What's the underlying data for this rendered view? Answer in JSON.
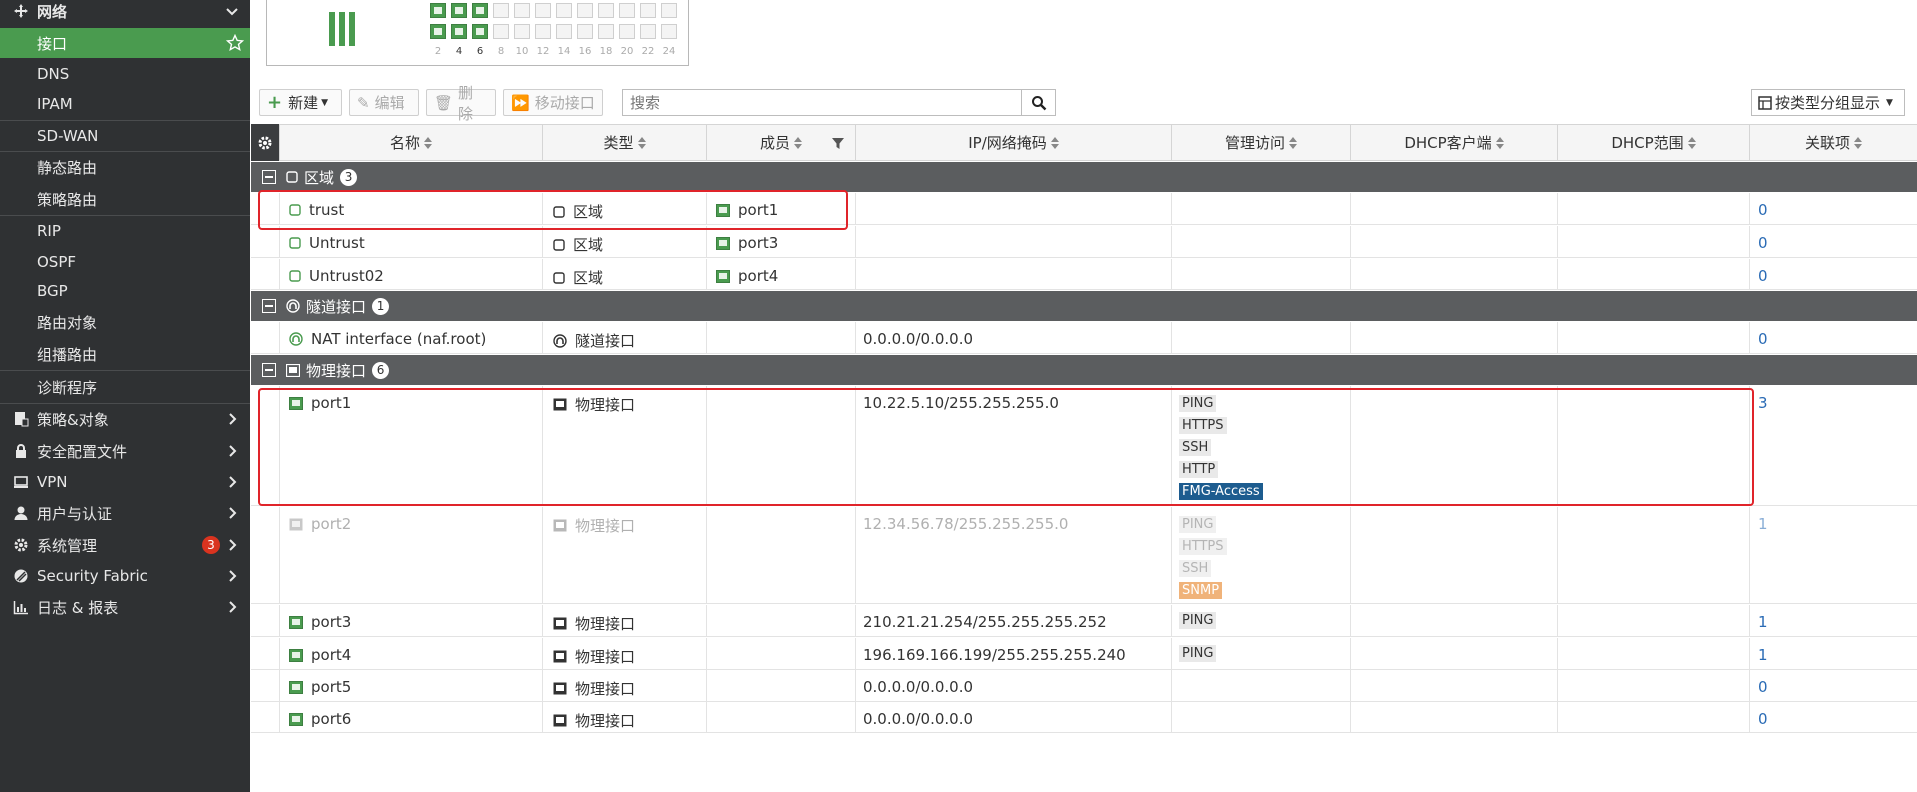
{
  "sidebar": {
    "network": "网络",
    "items": [
      {
        "label": "接口",
        "active": true
      },
      {
        "label": "DNS"
      },
      {
        "label": "IPAM"
      },
      {
        "label": "SD-WAN"
      },
      {
        "label": "静态路由"
      },
      {
        "label": "策略路由"
      },
      {
        "label": "RIP"
      },
      {
        "label": "OSPF"
      },
      {
        "label": "BGP"
      },
      {
        "label": "路由对象"
      },
      {
        "label": "组播路由"
      },
      {
        "label": "诊断程序"
      }
    ],
    "sections": [
      {
        "label": "策略&对象",
        "icon": "policy-icon"
      },
      {
        "label": "安全配置文件",
        "icon": "lock-icon"
      },
      {
        "label": "VPN",
        "icon": "monitor-icon"
      },
      {
        "label": "用户与认证",
        "icon": "user-icon"
      },
      {
        "label": "系统管理",
        "icon": "gear-icon",
        "badge": "3"
      },
      {
        "label": "Security Fabric",
        "icon": "fabric-icon"
      },
      {
        "label": "日志 & 报表",
        "icon": "chart-icon"
      }
    ]
  },
  "port_widget": {
    "numbers": [
      "2",
      "4",
      "6",
      "8",
      "10",
      "12",
      "14",
      "16",
      "18",
      "20",
      "22",
      "24"
    ]
  },
  "toolbar": {
    "new": "新建",
    "edit": "编辑",
    "delete": "删除",
    "move": "移动接口",
    "search_placeholder": "搜索",
    "group_by": "按类型分组显示"
  },
  "columns": [
    "名称",
    "类型",
    "成员",
    "IP/网络掩码",
    "管理访问",
    "DHCP客户端",
    "DHCP范围",
    "关联项"
  ],
  "groups": {
    "zone": {
      "label": "区域",
      "count": "3"
    },
    "tunnel": {
      "label": "隧道接口",
      "count": "1"
    },
    "physical": {
      "label": "物理接口",
      "count": "6"
    }
  },
  "zone_rows": [
    {
      "name": "trust",
      "type": "区域",
      "member": "port1",
      "ref": "0"
    },
    {
      "name": "Untrust",
      "type": "区域",
      "member": "port3",
      "ref": "0"
    },
    {
      "name": "Untrust02",
      "type": "区域",
      "member": "port4",
      "ref": "0"
    }
  ],
  "tunnel_rows": [
    {
      "name": "NAT interface (naf.root)",
      "type": "隧道接口",
      "ip": "0.0.0.0/0.0.0.0",
      "ref": "0"
    }
  ],
  "physical_rows": [
    {
      "name": "port1",
      "type": "物理接口",
      "ip": "10.22.5.10/255.255.255.0",
      "access": [
        "PING",
        "HTTPS",
        "SSH",
        "HTTP",
        "FMG-Access"
      ],
      "ref": "3"
    },
    {
      "name": "port2",
      "type": "物理接口",
      "ip": "12.34.56.78/255.255.255.0",
      "access": [
        "PING",
        "HTTPS",
        "SSH",
        "SNMP"
      ],
      "ref": "1"
    },
    {
      "name": "port3",
      "type": "物理接口",
      "ip": "210.21.21.254/255.255.255.252",
      "access": [
        "PING"
      ],
      "ref": "1"
    },
    {
      "name": "port4",
      "type": "物理接口",
      "ip": "196.169.166.199/255.255.255.240",
      "access": [
        "PING"
      ],
      "ref": "1"
    },
    {
      "name": "port5",
      "type": "物理接口",
      "ip": "0.0.0.0/0.0.0.0",
      "access": [],
      "ref": "0"
    },
    {
      "name": "port6",
      "type": "物理接口",
      "ip": "0.0.0.0/0.0.0.0",
      "access": [],
      "ref": "0"
    }
  ],
  "colors": {
    "accent": "#4a9b4f",
    "sidebar_bg": "#2f3133",
    "group_bg": "#5b5d5f",
    "highlight": "#e0242a",
    "link": "#2a6bb5",
    "badge": "#d9331f"
  }
}
